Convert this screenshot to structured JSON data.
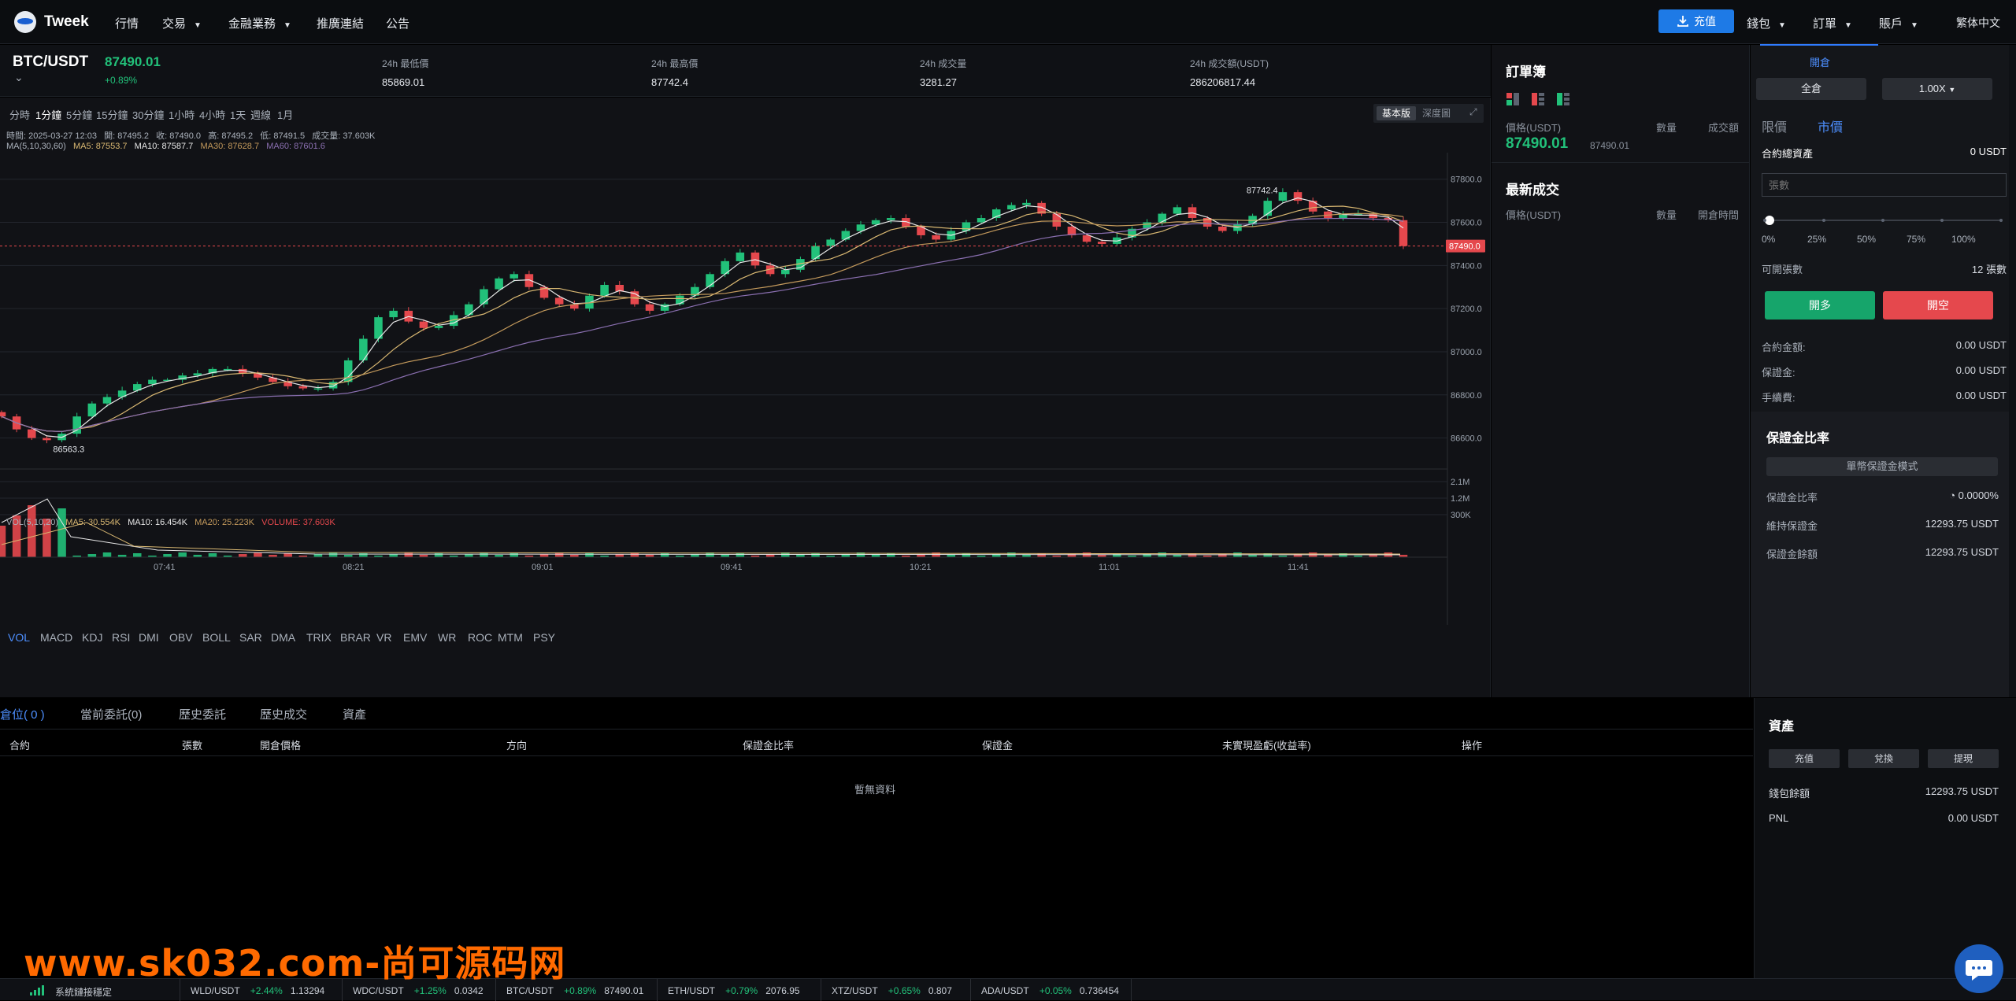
{
  "nav": {
    "logo": "Tweek",
    "items": [
      "行情",
      "交易",
      "金融業務",
      "推廣連結",
      "公告"
    ],
    "deposit": "充值",
    "right": [
      "錢包",
      "訂單",
      "賬戶"
    ],
    "language": "繁体中文"
  },
  "market": {
    "pair": "BTC/USDT",
    "price": "87490.01",
    "change": "+0.89%",
    "stats": [
      {
        "label": "24h 最低價",
        "value": "85869.01"
      },
      {
        "label": "24h 最高價",
        "value": "87742.4"
      },
      {
        "label": "24h 成交量",
        "value": "3281.27"
      },
      {
        "label": "24h 成交額(USDT)",
        "value": "286206817.44"
      }
    ]
  },
  "chart": {
    "timeframes": [
      "分時",
      "1分鐘",
      "5分鐘",
      "15分鐘",
      "30分鐘",
      "1小時",
      "4小時",
      "1天",
      "週線",
      "1月"
    ],
    "active_timeframe": "1分鐘",
    "views": [
      "基本版",
      "深度圖"
    ],
    "info_line": "時間: 2025-03-27 12:03   開: 87495.2   收: 87490.0   高: 87495.2   低: 87491.5   成交量: 37.603K",
    "ma_line": {
      "label": "MA(5,10,30,60)",
      "ma5": "MA5: 87553.7",
      "ma10": "MA10: 87587.7",
      "ma30": "MA30: 87628.7",
      "ma60": "MA60: 87601.6"
    },
    "price_axis": [
      "87800.0",
      "87600.0",
      "87400.0",
      "87200.0",
      "87000.0",
      "86800.0",
      "86600.0"
    ],
    "current_price_tag": "87490.0",
    "high_marker": "87742.4",
    "low_marker": "86563.3",
    "vol_line": {
      "label": "VOL(5,10,20)",
      "ma5": "MA5: 30.554K",
      "ma10": "MA10: 16.454K",
      "ma20": "MA20: 25.223K",
      "volume": "VOLUME: 37.603K"
    },
    "vol_axis": [
      "2.1M",
      "1.2M",
      "300K"
    ],
    "time_axis": [
      "07:41",
      "08:21",
      "09:01",
      "09:41",
      "10:21",
      "11:01",
      "11:41"
    ],
    "indicators": [
      "VOL",
      "MACD",
      "KDJ",
      "RSI",
      "DMI",
      "OBV",
      "BOLL",
      "SAR",
      "DMA",
      "TRIX",
      "BRAR",
      "VR",
      "EMV",
      "WR",
      "ROC",
      "MTM",
      "PSY"
    ],
    "active_indicator": "VOL",
    "colors": {
      "up": "#22c17a",
      "down": "#e5484d",
      "ma5": "#e8e8e8",
      "ma10": "#d9b872",
      "ma30": "#c49a5c",
      "ma60": "#8a6fb0"
    }
  },
  "chart_data": {
    "type": "candlestick",
    "y_range": [
      86500,
      87850
    ],
    "x": [
      "07:41",
      "08:21",
      "09:01",
      "09:41",
      "10:21",
      "11:01",
      "11:41"
    ],
    "close_trace": [
      86700,
      86640,
      86600,
      86590,
      86620,
      86700,
      86760,
      86790,
      86820,
      86850,
      86870,
      86870,
      86890,
      86900,
      86920,
      86920,
      86900,
      86880,
      86860,
      86840,
      86830,
      86830,
      86860,
      86960,
      87060,
      87160,
      87190,
      87140,
      87110,
      87120,
      87170,
      87220,
      87290,
      87340,
      87360,
      87300,
      87250,
      87220,
      87200,
      87260,
      87310,
      87280,
      87220,
      87190,
      87220,
      87260,
      87300,
      87360,
      87420,
      87460,
      87400,
      87360,
      87380,
      87430,
      87490,
      87520,
      87560,
      87590,
      87610,
      87620,
      87580,
      87540,
      87520,
      87560,
      87600,
      87620,
      87660,
      87680,
      87690,
      87640,
      87580,
      87540,
      87510,
      87500,
      87530,
      87570,
      87600,
      87640,
      87670,
      87620,
      87580,
      87560,
      87590,
      87630,
      87700,
      87740,
      87700,
      87650,
      87620,
      87640,
      87640,
      87620,
      87610,
      87490
    ]
  },
  "orderbook": {
    "title": "訂單簿",
    "cols": [
      "價格(USDT)",
      "數量",
      "成交額"
    ],
    "mid_price": "87490.01",
    "mid_sub": "87490.01",
    "trades_title": "最新成交",
    "trade_cols": [
      "價格(USDT)",
      "數量",
      "開倉時間"
    ]
  },
  "trade": {
    "tab": "開倉",
    "margin_mode": "全倉",
    "leverage": "1.00X",
    "order_types": [
      "限價",
      "市價"
    ],
    "total_asset_label": "合約總資產",
    "total_asset_value": "0 USDT",
    "qty_placeholder": "張數",
    "slider_marks": [
      "0%",
      "25%",
      "50%",
      "75%",
      "100%"
    ],
    "slider_value": 0,
    "open_qty_label": "可開張數",
    "open_qty_value": "12 張數",
    "long_btn": "開多",
    "short_btn": "開空",
    "rows": [
      {
        "label": "合約金額:",
        "value": "0.00 USDT"
      },
      {
        "label": "保證金:",
        "value": "0.00 USDT"
      },
      {
        "label": "手續費:",
        "value": "0.00 USDT"
      }
    ],
    "margin_title": "保證金比率",
    "margin_mode_btn": "單幣保證金模式",
    "margin_rows": [
      {
        "label": "保證金比率",
        "value": "0.0000%"
      },
      {
        "label": "維持保證金",
        "value": "12293.75 USDT"
      },
      {
        "label": "保證金餘額",
        "value": "12293.75 USDT"
      }
    ]
  },
  "positions": {
    "tabs": [
      "倉位( 0 )",
      "當前委託(0)",
      "歷史委託",
      "歷史成交",
      "資產"
    ],
    "cols": [
      "合約",
      "張數",
      "開倉價格",
      "方向",
      "保證金比率",
      "保證金",
      "未實現盈虧(收益率)",
      "操作"
    ],
    "empty": "暫無資料"
  },
  "assets": {
    "title": "資產",
    "buttons": [
      "充值",
      "兌換",
      "提現"
    ],
    "rows": [
      {
        "label": "錢包餘額",
        "value": "12293.75 USDT"
      },
      {
        "label": "PNL",
        "value": "0.00 USDT"
      }
    ]
  },
  "ticker": {
    "status": "系統鏈接穩定",
    "items": [
      {
        "pair": "WLD/USDT",
        "change": "+2.44%",
        "price": "1.13294"
      },
      {
        "pair": "WDC/USDT",
        "change": "+1.25%",
        "price": "0.0342"
      },
      {
        "pair": "BTC/USDT",
        "change": "+0.89%",
        "price": "87490.01"
      },
      {
        "pair": "ETH/USDT",
        "change": "+0.79%",
        "price": "2076.95"
      },
      {
        "pair": "XTZ/USDT",
        "change": "+0.65%",
        "price": "0.807"
      },
      {
        "pair": "ADA/USDT",
        "change": "+0.05%",
        "price": "0.736454"
      }
    ]
  },
  "watermark": "www.sk032.com-尚可源码网"
}
